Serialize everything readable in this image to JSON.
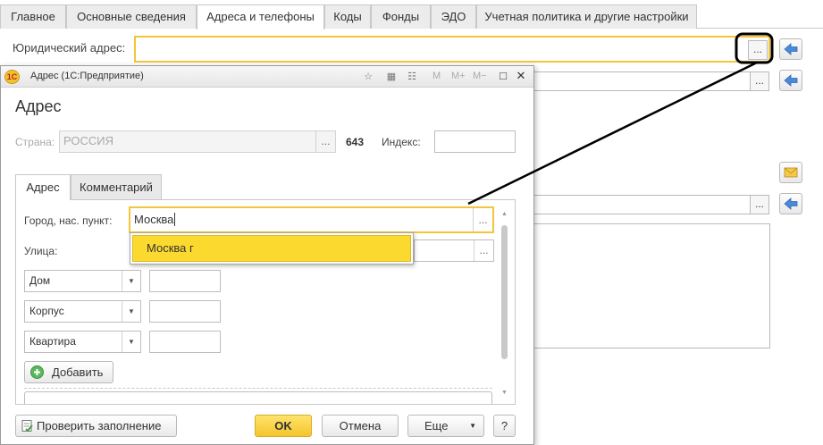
{
  "form": {
    "tabs": [
      "Главное",
      "Основные сведения",
      "Адреса и телефоны",
      "Коды",
      "Фонды",
      "ЭДО",
      "Учетная политика и другие настройки"
    ],
    "active_tab_index": 2,
    "legal_address_label": "Юридический адрес:",
    "legal_address_value": "",
    "dots_label": "..."
  },
  "dialog": {
    "window_title": "Адрес  (1С:Предприятие)",
    "toolbar_memory": [
      "M",
      "M+",
      "M−"
    ],
    "heading": "Адрес",
    "country_label": "Страна:",
    "country_value": "РОССИЯ",
    "country_code": "643",
    "index_label": "Индекс:",
    "index_value": "",
    "tabs": [
      "Адрес",
      "Комментарий"
    ],
    "active_tab_index": 0,
    "city_label": "Город, нас. пункт:",
    "city_value": "Москва",
    "street_label": "Улица:",
    "street_value": "",
    "dots_label": "...",
    "building_types": [
      {
        "label": "Дом",
        "value": ""
      },
      {
        "label": "Корпус",
        "value": ""
      },
      {
        "label": "Квартира",
        "value": ""
      }
    ],
    "add_button": "Добавить",
    "suggestion": "Москва г",
    "buttons": {
      "check": "Проверить заполнение",
      "ok": "OK",
      "cancel": "Отмена",
      "more": "Еще",
      "help": "?"
    }
  },
  "colors": {
    "accent_yellow": "#f3c53b",
    "selection_yellow": "#fcd92f",
    "arrow_blue": "#4a8ad8"
  }
}
